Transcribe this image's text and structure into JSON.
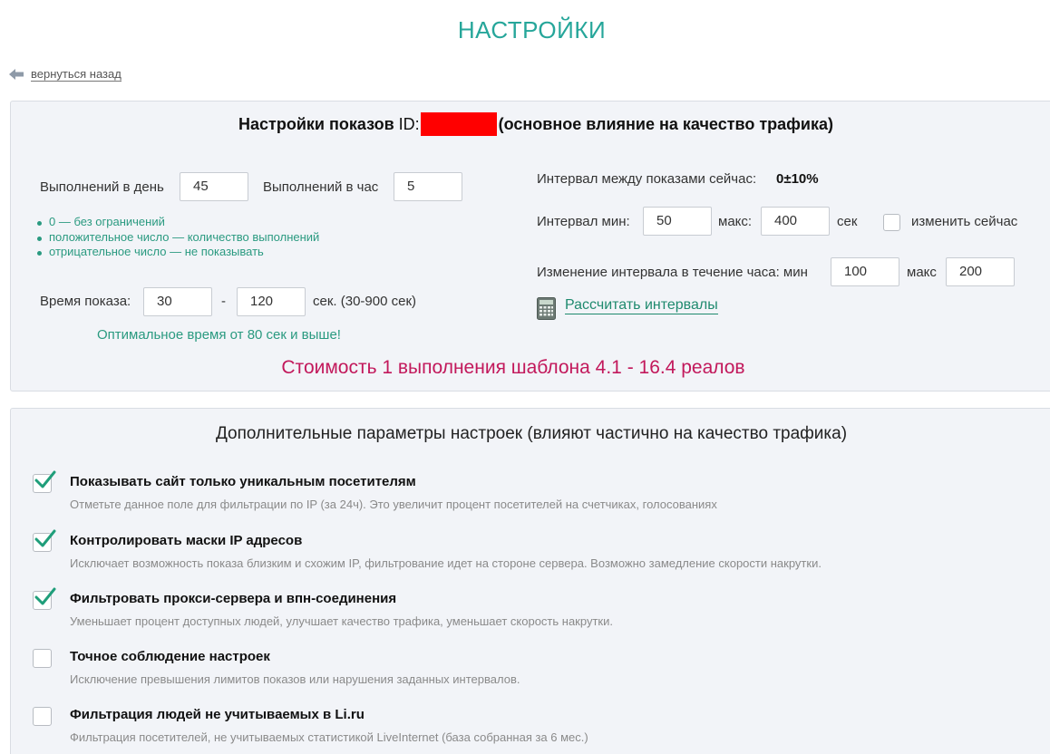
{
  "page": {
    "title": "НАСТРОЙКИ",
    "back_link": "вернуться назад"
  },
  "display_settings": {
    "title": "Настройки показов",
    "id_label": "ID:",
    "title_suffix": "(основное влияние на качество трафика)",
    "per_day_label": "Выполнений в день",
    "per_day_value": "45",
    "per_hour_label": "Выполнений в час",
    "per_hour_value": "5",
    "hints": [
      "0 — без ограничений",
      "положительное число — количество выполнений",
      "отрицательное число — не показывать"
    ],
    "show_time_label": "Время показа:",
    "show_time_min": "30",
    "show_time_dash": "-",
    "show_time_max": "120",
    "show_time_unit": "сек. (30-900 сек)",
    "optimal_text": "Оптимальное время от 80 сек и выше!",
    "interval_now_label": "Интервал между показами сейчас:",
    "interval_now_value": "0±10%",
    "interval_min_label": "Интервал мин:",
    "interval_min_value": "50",
    "interval_max_label": "макс:",
    "interval_max_value": "400",
    "interval_unit": "сек",
    "change_now_label": "изменить сейчас",
    "change_now_checked": false,
    "hour_change_label": "Изменение интервала в течение часа: мин",
    "hour_change_min": "100",
    "hour_change_max_label": "макс",
    "hour_change_max": "200",
    "calc_link": "Рассчитать интервалы",
    "cost_text": "Стоимость 1 выполнения шаблона 4.1 - 16.4 реалов"
  },
  "extra_settings": {
    "title": "Дополнительные параметры настроек (влияют частично на качество трафика)",
    "options": [
      {
        "title": "Показывать сайт только уникальным посетителям",
        "desc": "Отметьте данное поле для фильтрации по IP (за 24ч). Это увеличит процент посетителей на счетчиках, голосованиях",
        "checked": true
      },
      {
        "title": "Контролировать маски IP адресов",
        "desc": "Исключает возможность показа близким и схожим IP, фильтрование идет на стороне сервера. Возможно замедление скорости накрутки.",
        "checked": true
      },
      {
        "title": "Фильтровать прокси-сервера и впн-соединения",
        "desc": "Уменьшает процент доступных людей, улучшает качество трафика, уменьшает скорость накрутки.",
        "checked": true
      },
      {
        "title": "Точное соблюдение настроек",
        "desc": "Исключение превышения лимитов показов или нарушения заданных интервалов.",
        "checked": false
      },
      {
        "title": "Фильтрация людей не учитываемых в Li.ru",
        "desc": "Фильтрация посетителей, не учитываемых статистикой LiveInternet (база собранная за 6 мес.)",
        "checked": false
      }
    ]
  },
  "colors": {
    "accent": "#26a69a",
    "check": "#1f9e7a",
    "cost": "#c2185b",
    "redaction": "#ff0000"
  }
}
